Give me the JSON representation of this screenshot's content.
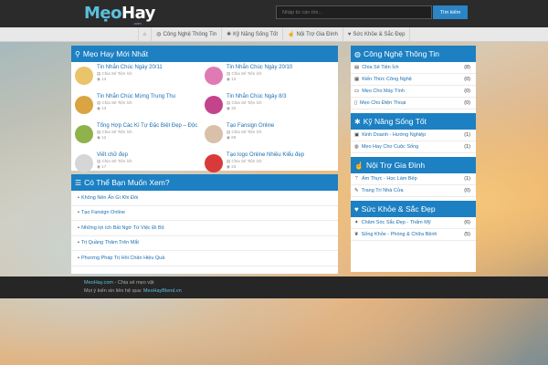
{
  "header": {
    "logo_meo": "Mẹo",
    "logo_hay": "Hay",
    "logo_sub": ".com",
    "search_placeholder": "Nhập từ cần tìm...",
    "search_button": "Tìm kiếm"
  },
  "nav": {
    "items": [
      {
        "icon": "home-icon",
        "label": ""
      },
      {
        "icon": "globe-icon",
        "label": "Công Nghệ Thông Tin"
      },
      {
        "icon": "lightbulb-icon",
        "label": "Kỹ Năng Sống Tốt"
      },
      {
        "icon": "thumbs-up-icon",
        "label": "Nội Trợ Gia Đình"
      },
      {
        "icon": "heart-icon",
        "label": "Sức Khỏe & Sắc Đẹp"
      }
    ]
  },
  "new_posts": {
    "title": "Mẹo Hay Mới Nhất",
    "posts": [
      {
        "title": "Tin Nhắn Chúc Ngày 20/11",
        "meta": "Chia Sẻ Tiện Ích",
        "views": "14",
        "color": "#e9c46a"
      },
      {
        "title": "Tin Nhắn Chúc Ngày 20/10",
        "meta": "Chia Sẻ Tiện Ích",
        "views": "13",
        "color": "#e07ab5"
      },
      {
        "title": "Tin Nhắn Chúc Mừng Trung Thu",
        "meta": "Chia Sẻ Tiện Ích",
        "views": "13",
        "color": "#d9a441"
      },
      {
        "title": "Tin Nhắn Chúc Ngày 8/3",
        "meta": "Chia Sẻ Tiện Ích",
        "views": "32",
        "color": "#c3448a"
      },
      {
        "title": "Tổng Hợp Các Kí Tự Đặc Biệt Đẹp – Độc",
        "meta": "Chia Sẻ Tiện Ích",
        "views": "12",
        "color": "#8fb24a"
      },
      {
        "title": "Tạo Fansign Online",
        "meta": "Chia Sẻ Tiện Ích",
        "views": "69",
        "color": "#d8c1a8"
      },
      {
        "title": "Viết chữ đẹp",
        "meta": "Chia Sẻ Tiện Ích",
        "views": "17",
        "color": "#d6d6d6"
      },
      {
        "title": "Tạo logo Online Nhiều Kiểu đẹp",
        "meta": "Chia Sẻ Tiện Ích",
        "views": "23",
        "color": "#d83a3a"
      }
    ]
  },
  "suggest": {
    "title": "Có Thể Bạn Muốn Xem?",
    "links": [
      "Không Nên Ăn Gì Khi Đói",
      "Tạo Fansign Online",
      "Những lợi ích Bất Ngờ Từ Việc Đi Bộ",
      "Trị Quầng Thâm Trên Mắt",
      "Phương Pháp Trị Hôi Chân Hiệu Quả"
    ]
  },
  "sidebar": {
    "sections": [
      {
        "title": "Công Nghệ Thông Tin",
        "icon": "globe-icon",
        "items": [
          {
            "icon": "folder-icon",
            "label": "Chia Sẻ Tiện Ích",
            "count": "(8)"
          },
          {
            "icon": "book-icon",
            "label": "Kiến Thức Công Nghệ",
            "count": "(0)"
          },
          {
            "icon": "monitor-icon",
            "label": "Mẹo Cho Máy Tính",
            "count": "(0)"
          },
          {
            "icon": "phone-icon",
            "label": "Mẹo Cho Điện Thoại",
            "count": "(0)"
          }
        ]
      },
      {
        "title": "Kỹ Năng Sống Tốt",
        "icon": "lightbulb-icon",
        "items": [
          {
            "icon": "briefcase-icon",
            "label": "Kinh Doanh - Hướng Nghiệp",
            "count": "(1)"
          },
          {
            "icon": "globe-icon",
            "label": "Mẹo Hay Cho Cuộc Sống",
            "count": "(1)"
          }
        ]
      },
      {
        "title": "Nội Trợ Gia Đình",
        "icon": "thumbs-up-icon",
        "items": [
          {
            "icon": "cutlery-icon",
            "label": "Ẩm Thực - Học Làm Bếp",
            "count": "(1)"
          },
          {
            "icon": "brush-icon",
            "label": "Trang Trí Nhà Cửa",
            "count": "(0)"
          }
        ]
      },
      {
        "title": "Sức Khỏe & Sắc Đẹp",
        "icon": "heart-icon",
        "items": [
          {
            "icon": "star-icon",
            "label": "Chăm Sóc Sắc Đẹp - Thẩm Mỹ",
            "count": "(6)"
          },
          {
            "icon": "leaf-icon",
            "label": "Sống Khỏe - Phòng & Chữa Bệnh",
            "count": "(5)"
          }
        ]
      }
    ]
  },
  "footer": {
    "site": "MeoHay.com",
    "tagline": " - Chia sẻ mẹo vặt",
    "contact_text": "Mọi ý kiến xin liên hệ qua: ",
    "contact_email": "MeoHayBlend.vn"
  }
}
